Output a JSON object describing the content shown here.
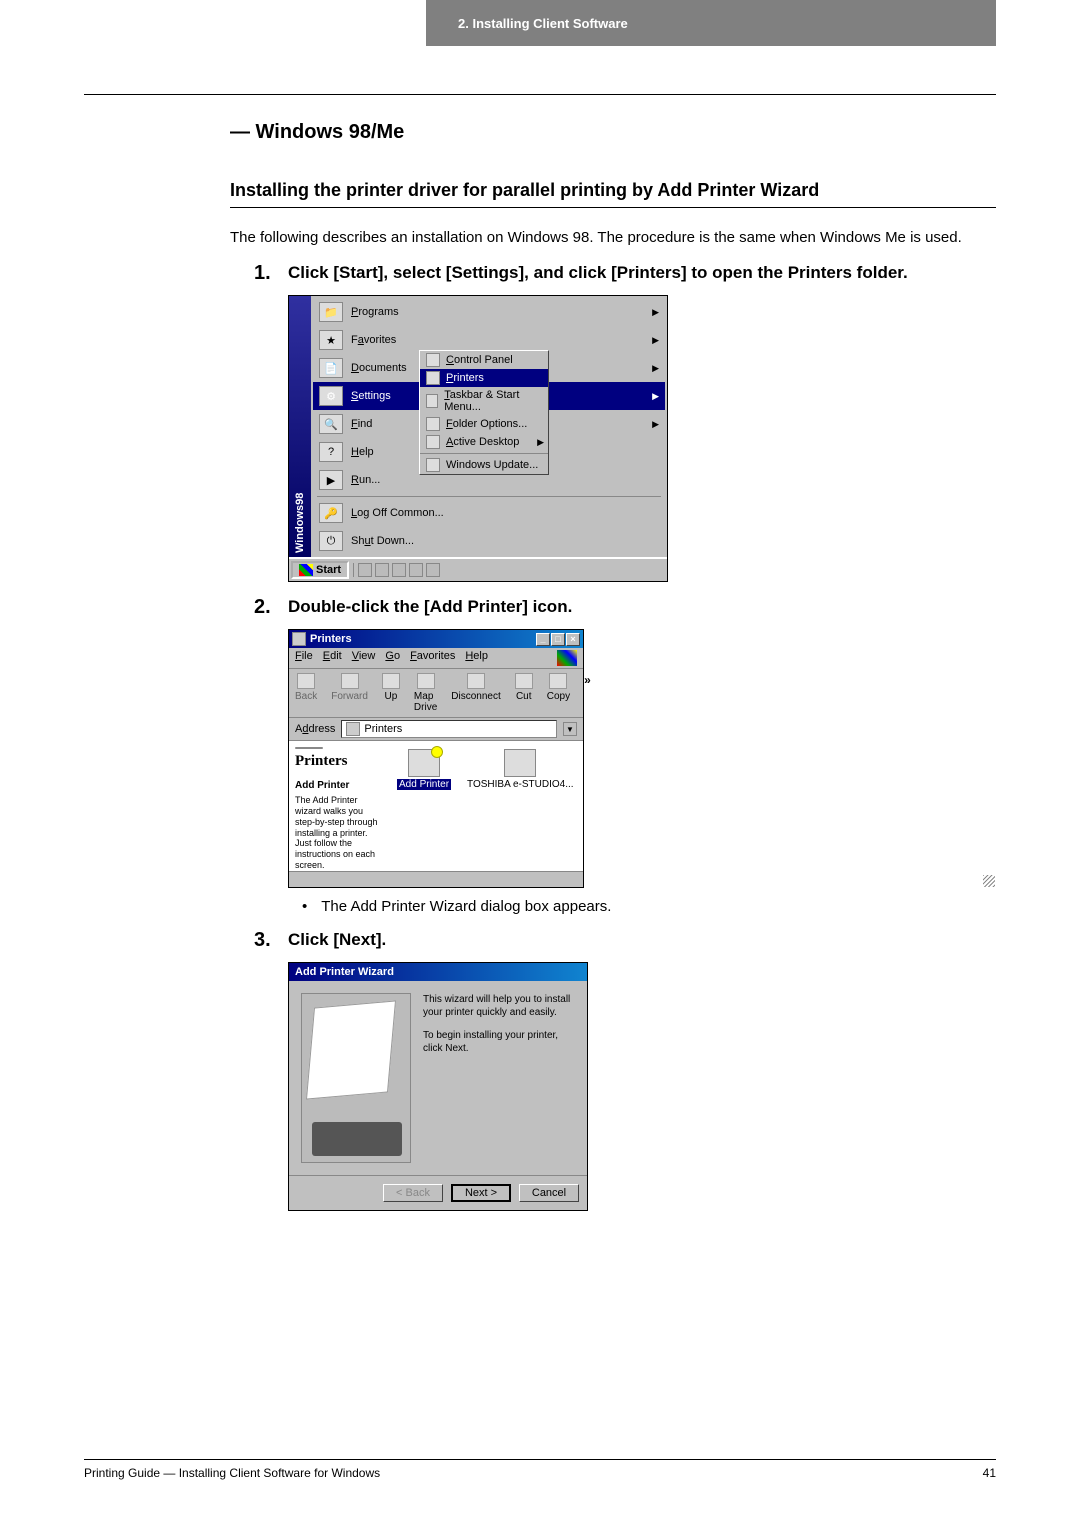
{
  "header": {
    "chapter": "2. Installing Client Software"
  },
  "section_title": "— Windows 98/Me",
  "subsection_title": "Installing the printer driver for parallel printing by Add Printer Wizard",
  "intro": "The following describes an installation on Windows 98.  The procedure is the same when Windows Me is used.",
  "steps": {
    "s1": {
      "num": "1.",
      "text": "Click [Start], select [Settings], and click [Printers] to open the Printers folder."
    },
    "s2": {
      "num": "2.",
      "text": "Double-click the [Add Printer] icon."
    },
    "s2_bullet": "The Add Printer Wizard dialog box appears.",
    "s3": {
      "num": "3.",
      "text": "Click [Next]."
    }
  },
  "ss1": {
    "sidebar": "Windows98",
    "items": {
      "programs": "Programs",
      "favorites": "Favorites",
      "documents": "Documents",
      "settings": "Settings",
      "find": "Find",
      "help": "Help",
      "run": "Run...",
      "logoff": "Log Off Common...",
      "shutdown": "Shut Down..."
    },
    "submenu": {
      "control_panel": "Control Panel",
      "printers": "Printers",
      "taskbar": "Taskbar & Start Menu...",
      "folder_options": "Folder Options...",
      "active_desktop": "Active Desktop",
      "windows_update": "Windows Update..."
    },
    "start": "Start"
  },
  "ss2": {
    "title": "Printers",
    "menubar": {
      "file": "File",
      "edit": "Edit",
      "view": "View",
      "go": "Go",
      "favorites": "Favorites",
      "help": "Help"
    },
    "toolbar": {
      "back": "Back",
      "forward": "Forward",
      "up": "Up",
      "map": "Map Drive",
      "disconnect": "Disconnect",
      "cut": "Cut",
      "copy": "Copy"
    },
    "address_label": "Address",
    "address_value": "Printers",
    "left": {
      "heading": "Printers",
      "sub": "Add Printer",
      "desc": "The Add Printer wizard walks you step-by-step through installing a printer. Just follow the instructions on each screen."
    },
    "icons": {
      "add_printer": "Add Printer",
      "toshiba": "TOSHIBA e-STUDIO4..."
    }
  },
  "ss3": {
    "title": "Add Printer Wizard",
    "line1": "This wizard will help you to install your printer quickly and easily.",
    "line2": "To begin installing your printer, click Next.",
    "back": "< Back",
    "next": "Next >",
    "cancel": "Cancel"
  },
  "footer": {
    "left": "Printing Guide — Installing Client Software for Windows",
    "right": "41"
  }
}
